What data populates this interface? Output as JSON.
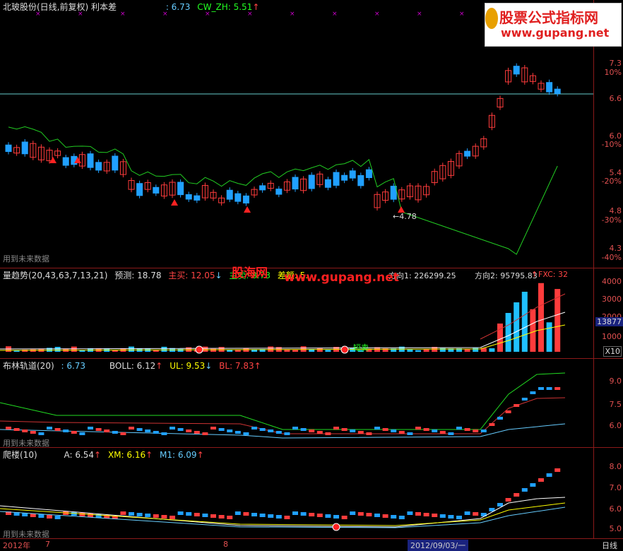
{
  "main": {
    "title": "北玻股份(日线,前复权) 利本差",
    "val1": ": 6.73",
    "cw_label": "CW_ZH: 5.51",
    "cw_arrow": "↑",
    "price_ticks": [
      "7.3",
      "6.6",
      "6.0",
      "5.4",
      "4.8",
      "4.3"
    ],
    "pct_ticks": [
      "10%",
      "-10%",
      "-20%",
      "-30%",
      "-40%"
    ],
    "low_label": "←4.78",
    "future_text": "用到未来数据"
  },
  "watermark": {
    "line1": "股票公式指标网",
    "line2": "www.gupang.net"
  },
  "vol": {
    "title": "量趋势(20,43,63,7,13,21)",
    "forecast": "预测: 18.78",
    "zhumai": "主买: 12.05",
    "zhumai_arrow": "↓",
    "zhumai2": "主卖: 8.73",
    "chayi": "差额: 5.",
    "fangxiang1": "方向1: 226299.25",
    "fangxiang2": "方向2: 95795.83",
    "fangxiang2_arrow": "↑",
    "fxc": "FXC: 32",
    "wm_overlay1": "股海网",
    "wm_overlay2": "www.gupang.net",
    "short_sell": "短卖",
    "ticks": [
      "4000",
      "3000",
      "2000",
      "1000"
    ],
    "cur_vol": "13877",
    "mult": "X10"
  },
  "boll": {
    "title": "布林轨道(20)",
    "val": ": 6.73",
    "boll": "BOLL: 6.12",
    "boll_arrow": "↑",
    "ul": "UL: 9.53",
    "ul_arrow": "↓",
    "bl": "BL: 7.83",
    "bl_arrow": "↑",
    "ticks": [
      "9.0",
      "7.5",
      "6.0"
    ],
    "future_text": "用到未来数据"
  },
  "climb": {
    "title": "爬楼(10)",
    "a": "A: 6.54",
    "a_arrow": "↑",
    "xm": "XM: 6.16",
    "xm_arrow": "↑",
    "m1": "M1: 6.09",
    "m1_arrow": "↑",
    "ticks": [
      "8.0",
      "7.0",
      "6.0",
      "5.0"
    ],
    "future_text": "用到未来数据"
  },
  "bottom": {
    "year": "2012年",
    "m7": "7",
    "m8": "8",
    "date": "2012/09/03/一",
    "period": "日线"
  },
  "colors": {
    "up": "#ff3c3c",
    "down": "#20a0ff",
    "ma": "#22cc22",
    "hline": "#66cccc",
    "axis": "#e05050"
  }
}
